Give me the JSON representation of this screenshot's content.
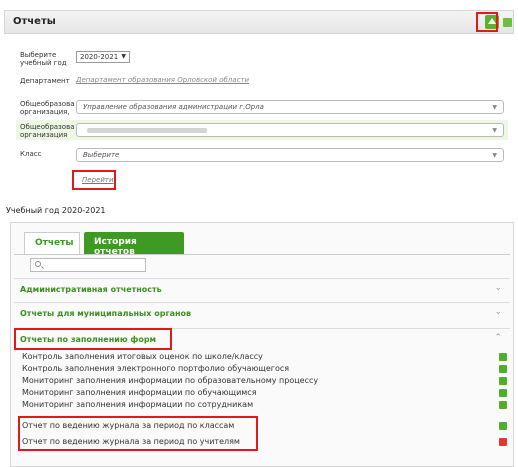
{
  "header": {
    "title": "Отчеты"
  },
  "filters": {
    "year_label": "Выберите учебный год",
    "year_value": "2020-2021",
    "dept_label": "Департамент",
    "dept_value": "Департамент образования Орловской области",
    "org1_label": "Общеобразова организация,",
    "org1_value": "Управление образования администрации г.Орла",
    "org2_label": "Общеобразова организация",
    "class_label": "Класс",
    "class_value": "Выберите",
    "apply_label": "Перейти"
  },
  "year_text": "Учебный год 2020-2021",
  "tabs": [
    {
      "label": "Отчеты"
    },
    {
      "label": "История отчетов"
    }
  ],
  "sections": [
    {
      "title": "Административная отчетность"
    },
    {
      "title": "Отчеты для муниципальных органов"
    },
    {
      "title": "Отчеты по заполнению форм"
    }
  ],
  "items": [
    {
      "label": "Контроль заполнения итоговых оценок по школе/классу",
      "icon": "green"
    },
    {
      "label": "Контроль заполнения электронного портфолио обучающегося",
      "icon": "green"
    },
    {
      "label": "Мониторинг заполнения информации по образовательному процессу",
      "icon": "green"
    },
    {
      "label": "Мониторинг заполнения информации по обучающимся",
      "icon": "green"
    },
    {
      "label": "Мониторинг заполнения информации по сотрудникам",
      "icon": "green"
    },
    {
      "label": "Отчет по ведению журнала за период по классам",
      "icon": "green"
    },
    {
      "label": "Отчет по ведению журнала за период по учителям",
      "icon": "red"
    }
  ],
  "colors": {
    "accent": "#3f9a24",
    "highlight": "#e01a1a"
  },
  "icons": {
    "collapse": "chevron-down-icon",
    "expand": "chevron-up-icon",
    "search": "search-icon"
  }
}
